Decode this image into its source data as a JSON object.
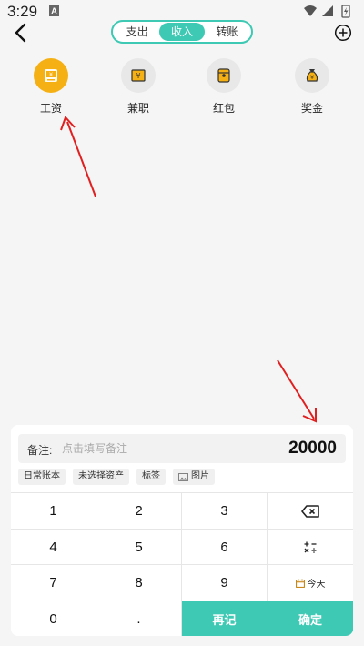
{
  "status_bar": {
    "time": "3:29",
    "notif": "A"
  },
  "header": {
    "tabs": [
      {
        "label": "支出",
        "active": false
      },
      {
        "label": "收入",
        "active": true
      },
      {
        "label": "转账",
        "active": false
      }
    ]
  },
  "categories": [
    {
      "label": "工资",
      "icon": "salary-icon",
      "selected": true
    },
    {
      "label": "兼职",
      "icon": "part-time-icon",
      "selected": false
    },
    {
      "label": "红包",
      "icon": "red-packet-icon",
      "selected": false
    },
    {
      "label": "奖金",
      "icon": "bonus-icon",
      "selected": false
    }
  ],
  "entry": {
    "note_label": "备注:",
    "note_placeholder": "点击填写备注",
    "amount": "20000"
  },
  "chips": [
    "日常账本",
    "未选择资产",
    "标签",
    "图片"
  ],
  "keypad": {
    "digits": [
      "1",
      "2",
      "3",
      "4",
      "5",
      "6",
      "7",
      "8",
      "9",
      "0",
      "."
    ],
    "today": "今天",
    "again": "再记",
    "confirm": "确定"
  },
  "colors": {
    "accent": "#3dc9b3",
    "selected": "#f5b014",
    "arrow": "#e02020"
  }
}
